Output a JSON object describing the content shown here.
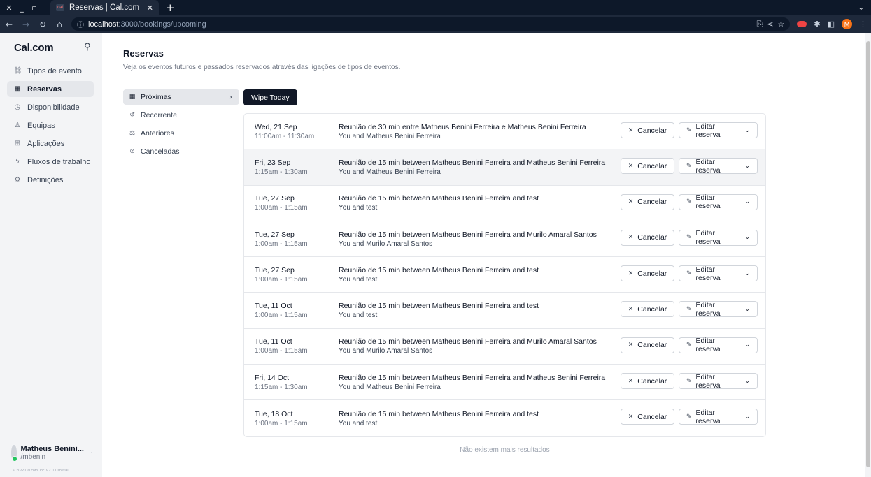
{
  "browser": {
    "tab_title": "Reservas | Cal.com",
    "favicon_text": "cal",
    "url_host": "localhost",
    "url_path": ":3000/bookings/upcoming",
    "profile_initial": "M"
  },
  "sidebar": {
    "brand": "Cal.com",
    "items": [
      {
        "label": "Tipos de evento",
        "icon": "link-icon"
      },
      {
        "label": "Reservas",
        "icon": "calendar-icon"
      },
      {
        "label": "Disponibilidade",
        "icon": "clock-icon"
      },
      {
        "label": "Equipas",
        "icon": "users-icon"
      },
      {
        "label": "Aplicações",
        "icon": "grid-icon"
      },
      {
        "label": "Fluxos de trabalho",
        "icon": "zap-icon"
      },
      {
        "label": "Definições",
        "icon": "settings-icon"
      }
    ],
    "user": {
      "name": "Matheus Benini...",
      "handle": "/mbenin"
    },
    "copyright": "© 2022 Cal.com, Inc. v.2.0.1-sh-trial"
  },
  "page": {
    "title": "Reservas",
    "subtitle": "Veja os eventos futuros e passados reservados através das ligações de tipos de eventos.",
    "wipe_label": "Wipe Today",
    "end_message": "Não existem mais resultados"
  },
  "subnav": [
    {
      "label": "Próximas"
    },
    {
      "label": "Recorrente"
    },
    {
      "label": "Anteriores"
    },
    {
      "label": "Canceladas"
    }
  ],
  "buttons": {
    "cancel": "Cancelar",
    "edit": "Editar reserva"
  },
  "bookings": [
    {
      "date": "Wed, 21 Sep",
      "time": "11:00am - 11:30am",
      "title": "Reunião de 30 min entre Matheus Benini Ferreira e Matheus Benini Ferreira",
      "attendees": "You and Matheus Benini Ferreira"
    },
    {
      "date": "Fri, 23 Sep",
      "time": "1:15am - 1:30am",
      "title": "Reunião de 15 min between Matheus Benini Ferreira and Matheus Benini Ferreira",
      "attendees": "You and Matheus Benini Ferreira"
    },
    {
      "date": "Tue, 27 Sep",
      "time": "1:00am - 1:15am",
      "title": "Reunião de 15 min between Matheus Benini Ferreira and test",
      "attendees": "You and test"
    },
    {
      "date": "Tue, 27 Sep",
      "time": "1:00am - 1:15am",
      "title": "Reunião de 15 min between Matheus Benini Ferreira and Murilo Amaral Santos",
      "attendees": "You and Murilo Amaral Santos"
    },
    {
      "date": "Tue, 27 Sep",
      "time": "1:00am - 1:15am",
      "title": "Reunião de 15 min between Matheus Benini Ferreira and test",
      "attendees": "You and test"
    },
    {
      "date": "Tue, 11 Oct",
      "time": "1:00am - 1:15am",
      "title": "Reunião de 15 min between Matheus Benini Ferreira and test",
      "attendees": "You and test"
    },
    {
      "date": "Tue, 11 Oct",
      "time": "1:00am - 1:15am",
      "title": "Reunião de 15 min between Matheus Benini Ferreira and Murilo Amaral Santos",
      "attendees": "You and Murilo Amaral Santos"
    },
    {
      "date": "Fri, 14 Oct",
      "time": "1:15am - 1:30am",
      "title": "Reunião de 15 min between Matheus Benini Ferreira and Matheus Benini Ferreira",
      "attendees": "You and Matheus Benini Ferreira"
    },
    {
      "date": "Tue, 18 Oct",
      "time": "1:00am - 1:15am",
      "title": "Reunião de 15 min between Matheus Benini Ferreira and test",
      "attendees": "You and test"
    }
  ]
}
